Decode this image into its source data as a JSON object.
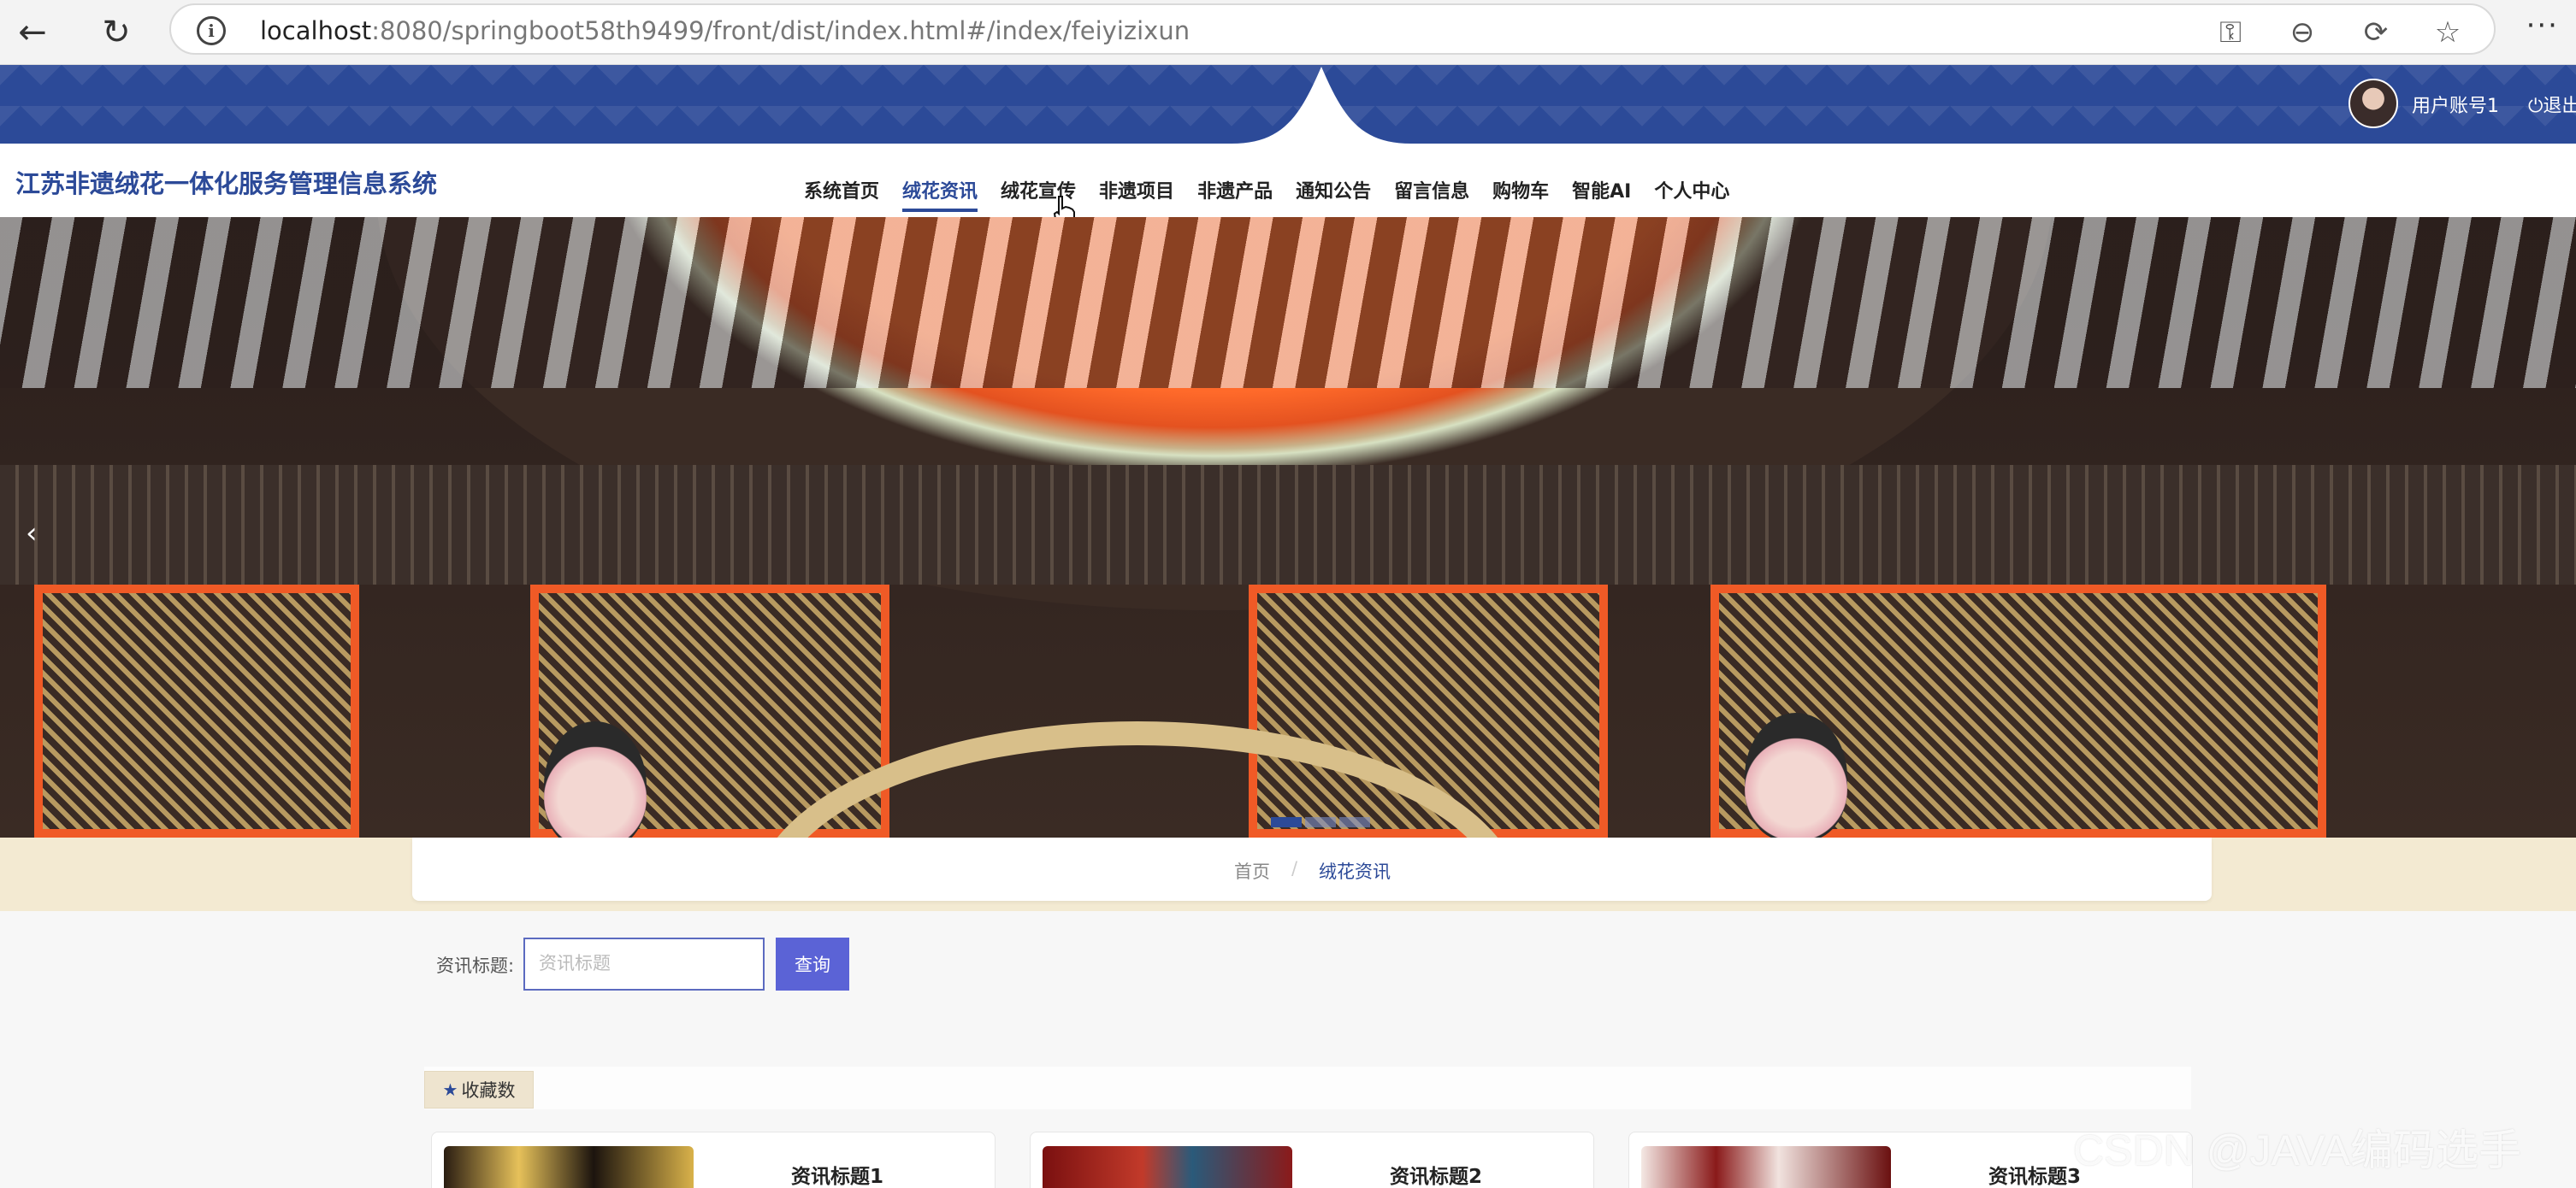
{
  "browser": {
    "url_host": "localhost",
    "url_rest": ":8080/springboot58th9499/front/dist/index.html#/index/feiyizixun",
    "icons": [
      "back-arrow-icon",
      "reload-icon",
      "info-icon",
      "key-icon",
      "zoom-out-icon",
      "sync-icon",
      "star-icon",
      "more-icon"
    ]
  },
  "header": {
    "user_name": "用户账号1",
    "logout_label": "退出",
    "brand_color": "#2c4a98"
  },
  "site": {
    "title": "江苏非遗绒花一体化服务管理信息系统"
  },
  "nav": {
    "items": [
      {
        "label": "系统首页",
        "active": false
      },
      {
        "label": "绒花资讯",
        "active": true
      },
      {
        "label": "绒花宣传",
        "active": false
      },
      {
        "label": "非遗项目",
        "active": false
      },
      {
        "label": "非遗产品",
        "active": false
      },
      {
        "label": "通知公告",
        "active": false
      },
      {
        "label": "留言信息",
        "active": false
      },
      {
        "label": "购物车",
        "active": false
      },
      {
        "label": "智能AI",
        "active": false
      },
      {
        "label": "个人中心",
        "active": false
      }
    ]
  },
  "banner": {
    "prev_label": "‹",
    "slide_count": 3,
    "active_slide": 1
  },
  "breadcrumb": {
    "home": "首页",
    "current": "绒花资讯"
  },
  "search": {
    "label": "资讯标题:",
    "placeholder": "资讯标题",
    "value": "",
    "button_label": "查询"
  },
  "sort": {
    "label": "收藏数",
    "icon": "star-icon"
  },
  "list": {
    "items": [
      {
        "title": "资讯标题1"
      },
      {
        "title": "资讯标题2"
      },
      {
        "title": "资讯标题3"
      }
    ]
  },
  "watermark": "CSDN @JAVA编码选手"
}
